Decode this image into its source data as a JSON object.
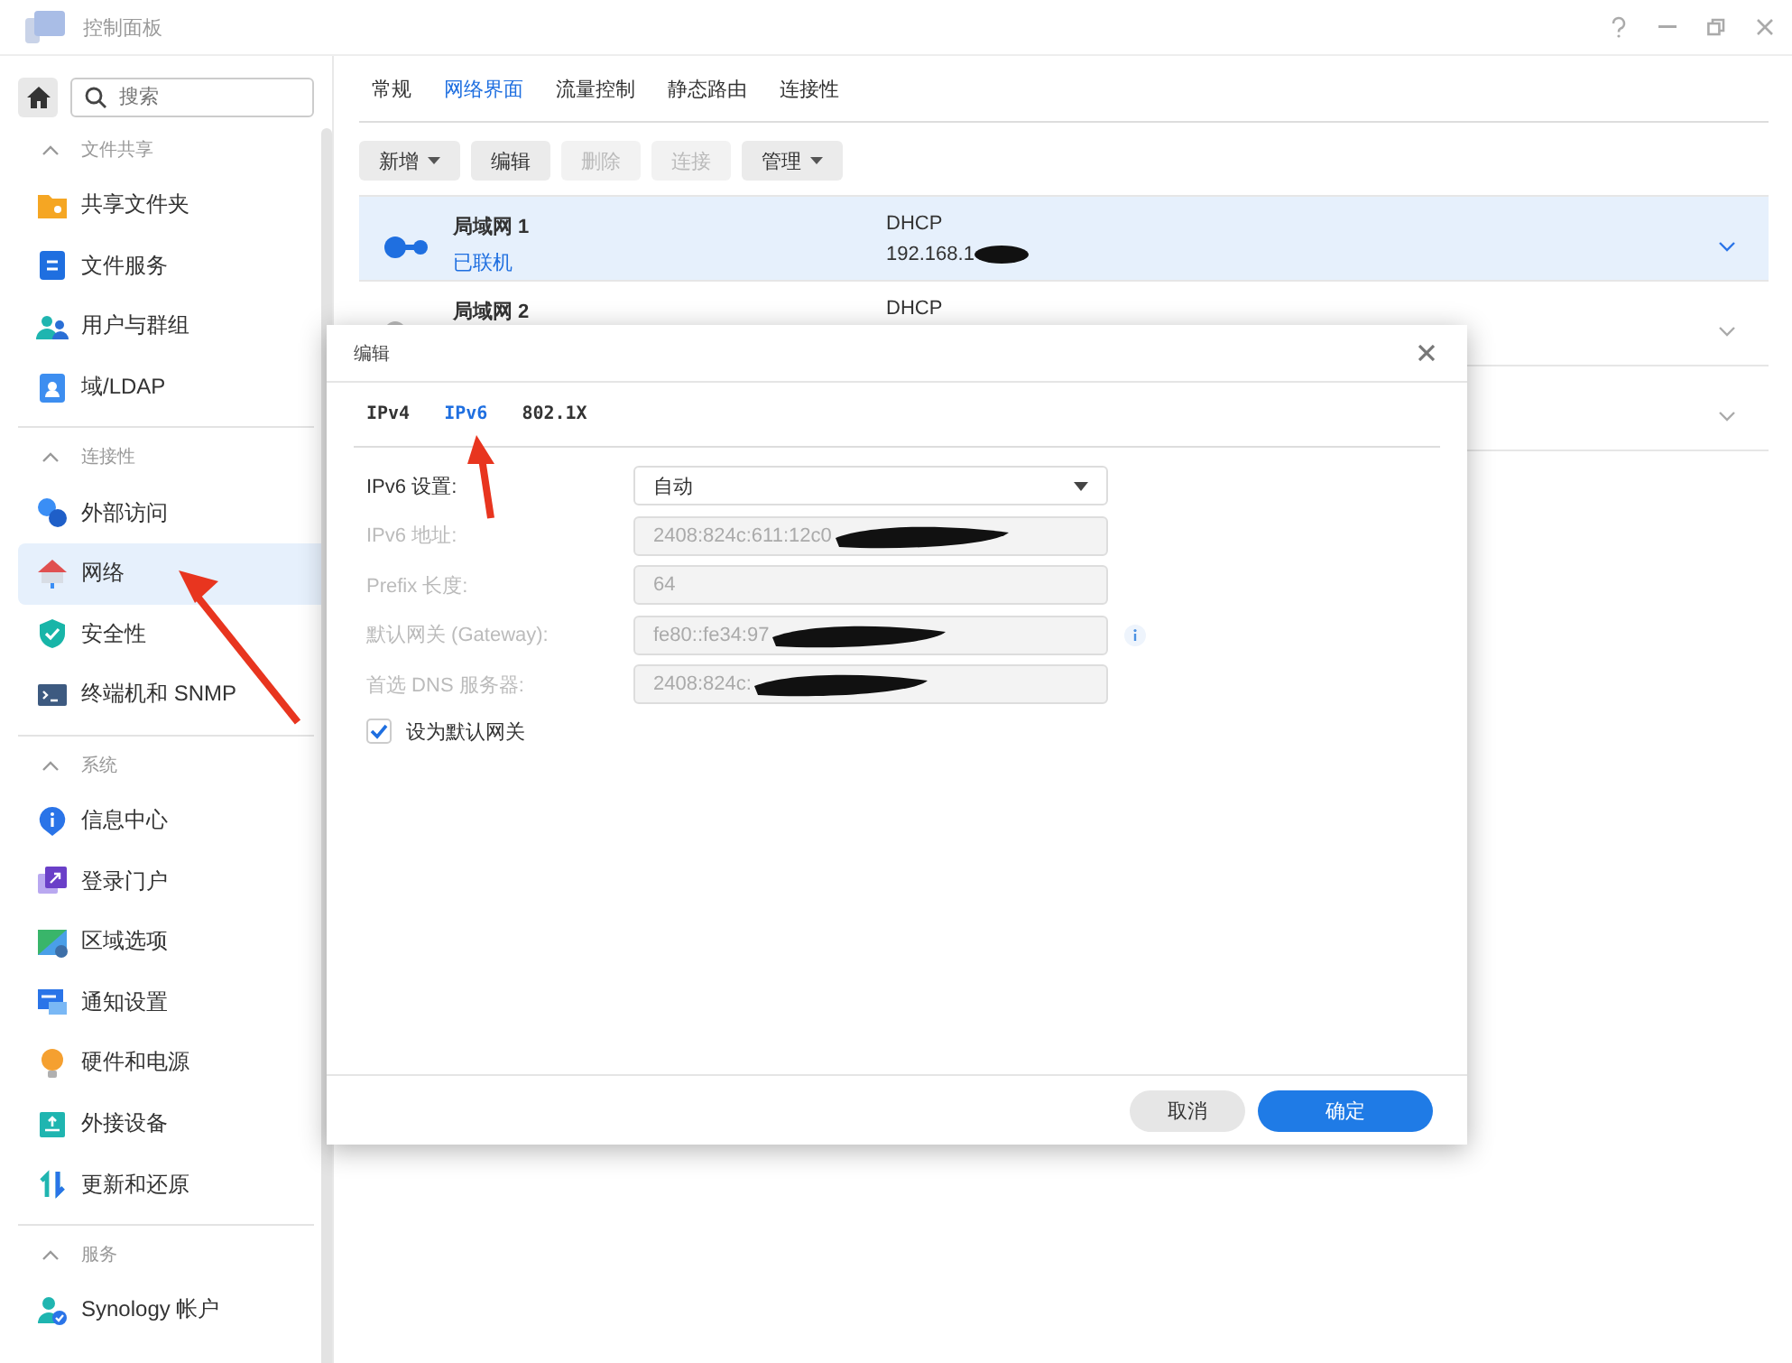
{
  "window": {
    "title": "控制面板"
  },
  "sidebar": {
    "search": {
      "placeholder": "搜索"
    },
    "sections": [
      {
        "title": "文件共享",
        "expanded": true,
        "items": [
          {
            "label": "共享文件夹",
            "selected": false
          },
          {
            "label": "文件服务",
            "selected": false
          },
          {
            "label": "用户与群组",
            "selected": false
          },
          {
            "label": "域/LDAP",
            "selected": false
          }
        ]
      },
      {
        "title": "连接性",
        "expanded": true,
        "items": [
          {
            "label": "外部访问",
            "selected": false
          },
          {
            "label": "网络",
            "selected": true
          },
          {
            "label": "安全性",
            "selected": false
          },
          {
            "label": "终端机和 SNMP",
            "selected": false
          }
        ]
      },
      {
        "title": "系统",
        "expanded": true,
        "items": [
          {
            "label": "信息中心",
            "selected": false
          },
          {
            "label": "登录门户",
            "selected": false
          },
          {
            "label": "区域选项",
            "selected": false
          },
          {
            "label": "通知设置",
            "selected": false
          },
          {
            "label": "硬件和电源",
            "selected": false
          },
          {
            "label": "外接设备",
            "selected": false
          },
          {
            "label": "更新和还原",
            "selected": false
          }
        ]
      },
      {
        "title": "服务",
        "expanded": true,
        "items": [
          {
            "label": "Synology 帐户",
            "selected": false
          }
        ]
      }
    ]
  },
  "tabs": [
    {
      "label": "常规",
      "selected": false
    },
    {
      "label": "网络界面",
      "selected": true
    },
    {
      "label": "流量控制",
      "selected": false
    },
    {
      "label": "静态路由",
      "selected": false
    },
    {
      "label": "连接性",
      "selected": false
    }
  ],
  "toolbar": [
    {
      "label": "新增",
      "disabled": false,
      "dropdown": true
    },
    {
      "label": "编辑",
      "disabled": false,
      "dropdown": false
    },
    {
      "label": "删除",
      "disabled": true,
      "dropdown": false
    },
    {
      "label": "连接",
      "disabled": true,
      "dropdown": false
    },
    {
      "label": "管理",
      "disabled": false,
      "dropdown": true
    }
  ],
  "interfaces": [
    {
      "name": "局域网 1",
      "status": "已联机",
      "connected": true,
      "mode": "DHCP",
      "address": "192.168.1",
      "redacted": true,
      "selected": true
    },
    {
      "name": "局域网 2",
      "connected": false,
      "mode": "DHCP",
      "selected": false
    },
    {
      "selected": false
    }
  ],
  "dialog": {
    "title": "编辑",
    "tabs": [
      {
        "label": "IPv4",
        "selected": false
      },
      {
        "label": "IPv6",
        "selected": true
      },
      {
        "label": "802.1X",
        "selected": false
      }
    ],
    "fields": [
      {
        "kind": "select",
        "label": "IPv6 设置:",
        "value": "自动",
        "disabled": false
      },
      {
        "kind": "text",
        "label": "IPv6 地址:",
        "value": "2408:824c:611:12c0",
        "disabled": true,
        "redacted": true
      },
      {
        "kind": "text",
        "label": "Prefix 长度:",
        "value": "64",
        "disabled": true
      },
      {
        "kind": "text",
        "label": "默认网关 (Gateway):",
        "value": "fe80::fe34:97",
        "disabled": true,
        "redacted": true,
        "info": true
      },
      {
        "kind": "text",
        "label": "首选 DNS 服务器:",
        "value": "2408:824c:",
        "disabled": true,
        "redacted": true
      }
    ],
    "checkbox": {
      "label": "设为默认网关",
      "checked": true
    },
    "buttons": [
      {
        "label": "取消",
        "kind": "secondary"
      },
      {
        "label": "确定",
        "kind": "primary"
      }
    ]
  }
}
